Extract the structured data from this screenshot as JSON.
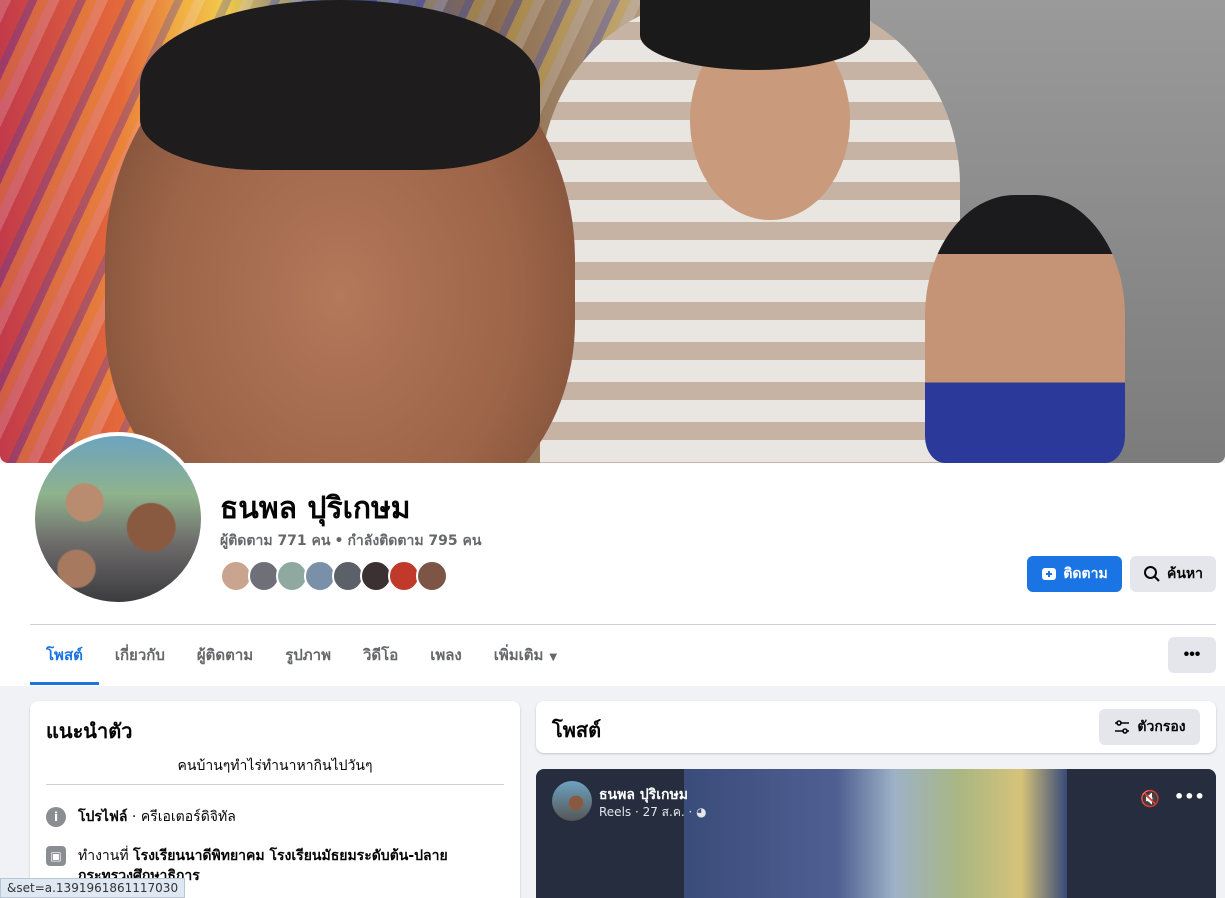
{
  "profile": {
    "name": "ธนพล ปุริเกษม",
    "followers": "ผู้ติดตาม 771 คน",
    "following": "กำลังติดตาม 795 คน",
    "separator": "•"
  },
  "friend_avatars": [
    {
      "color": "#c9a48e"
    },
    {
      "color": "#6f6f78"
    },
    {
      "color": "#8fa9a1"
    },
    {
      "color": "#7a8fa8"
    },
    {
      "color": "#5c6068"
    },
    {
      "color": "#3b3032"
    },
    {
      "color": "#c0392b"
    },
    {
      "color": "#7d5546"
    }
  ],
  "actions": {
    "follow_label": "ติดตาม",
    "search_label": "ค้นหา"
  },
  "tabs": [
    {
      "label": "โพสต์",
      "active": true
    },
    {
      "label": "เกี่ยวกับ"
    },
    {
      "label": "ผู้ติดตาม"
    },
    {
      "label": "รูปภาพ"
    },
    {
      "label": "วิดีโอ"
    },
    {
      "label": "เพลง"
    },
    {
      "label": "เพิ่มเติม",
      "dropdown": true
    }
  ],
  "more_button": "•••",
  "intro": {
    "title": "แนะนำตัว",
    "bio": "คนบ้านๆทำไร่ทำนาหากินไปวันๆ",
    "profile_label": "โปรไฟล์",
    "profile_value": " · ครีเอเตอร์ดิจิทัล",
    "work_prefix": "ทำงานที่ ",
    "work_value": "โรงเรียนนาดีพิทยาคม โรงเรียนมัธยมระดับต้น-ปลาย กระทรวงศึกษาธิการ"
  },
  "posts": {
    "title": "โพสต์",
    "filter_label": "ตัวกรอง"
  },
  "reel": {
    "author": "ธนพล ปุริเกษม",
    "meta": "Reels · 27 ส.ค. · ",
    "globe_icon": "◕",
    "mute_icon": "🔇",
    "menu": "•••"
  },
  "status_url": "&set=a.1391961861117030",
  "colors": {
    "accent": "#1b74e4",
    "secondary_text": "#65676b",
    "page_bg": "#f0f2f5"
  }
}
